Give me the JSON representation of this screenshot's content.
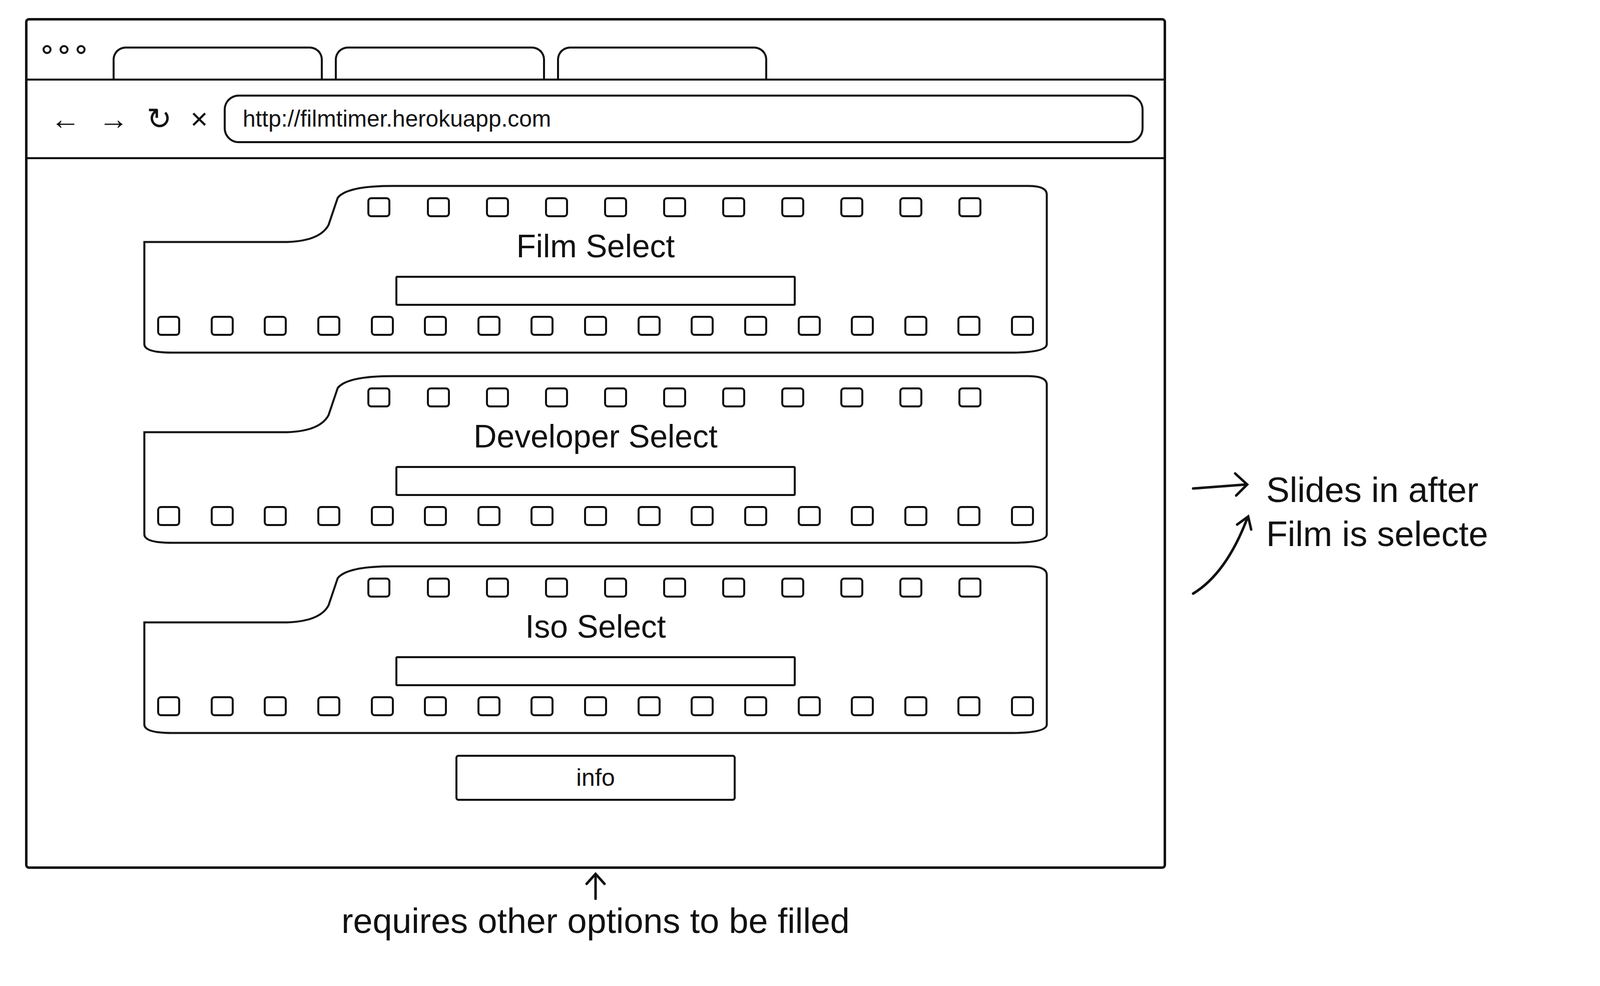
{
  "browser": {
    "nav": [
      "←",
      "→",
      "↻",
      "×"
    ],
    "address": "http://filmtimer.herokuapp.com"
  },
  "panels": [
    {
      "title": "Film Select"
    },
    {
      "title": "Developer Select"
    },
    {
      "title": "Iso Select"
    }
  ],
  "button": "info",
  "notes": {
    "side": [
      "Slides in after",
      "Film is selecte"
    ],
    "bottom": "requires other options to be filled"
  }
}
